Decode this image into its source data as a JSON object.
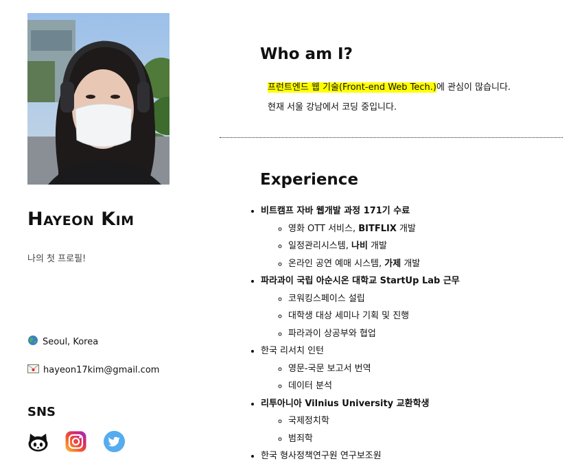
{
  "profile": {
    "name": "Hayeon Kim",
    "tagline": "나의 첫 프로필!",
    "location": "Seoul, Korea",
    "email": "hayeon17kim@gmail.com",
    "sns_title": "SNS",
    "sns_icons": [
      "github-icon",
      "instagram-icon",
      "twitter-icon"
    ]
  },
  "about": {
    "title": "Who am I?",
    "line1_highlight": "프런트엔드 웹 기술(Front-end Web Tech.)",
    "line1_rest": "에 관심이 많습니다.",
    "line2": "현재 서울 강남에서 코딩 중입니다."
  },
  "experience": {
    "title": "Experience",
    "items": [
      {
        "title": "비트캠프 자바 웹개발 과정 171기 수료",
        "bold": true,
        "subs": [
          {
            "pre": "영화 OTT 서비스, ",
            "bold": "BITFLIX",
            "post": " 개발"
          },
          {
            "pre": "일정관리시스템, ",
            "bold": "나비",
            "post": " 개발"
          },
          {
            "pre": "온라인 공연 예매 시스템, ",
            "bold": "가제",
            "post": " 개발"
          }
        ]
      },
      {
        "title": "파라과이 국립 아순시온 대학교 StartUp Lab 근무",
        "bold": true,
        "subs": [
          {
            "pre": "코워킹스페이스 설립",
            "bold": "",
            "post": ""
          },
          {
            "pre": "대학생 대상 세미나 기획 및 진행",
            "bold": "",
            "post": ""
          },
          {
            "pre": "파라과이 상공부와 협업",
            "bold": "",
            "post": ""
          }
        ]
      },
      {
        "title": "한국 리서치 인턴",
        "bold": false,
        "subs": [
          {
            "pre": "영문-국문 보고서 번역",
            "bold": "",
            "post": ""
          },
          {
            "pre": "데이터 분석",
            "bold": "",
            "post": ""
          }
        ]
      },
      {
        "title": "리투아니아 Vilnius University 교환학생",
        "bold": true,
        "subs": [
          {
            "pre": "국제정치학",
            "bold": "",
            "post": ""
          },
          {
            "pre": "범죄학",
            "bold": "",
            "post": ""
          }
        ]
      },
      {
        "title": "한국 형사정책연구원 연구보조원",
        "bold": false,
        "subs": []
      }
    ]
  },
  "colors": {
    "highlight": "#ffff00",
    "twitter": "#55acee",
    "text": "#111111"
  }
}
